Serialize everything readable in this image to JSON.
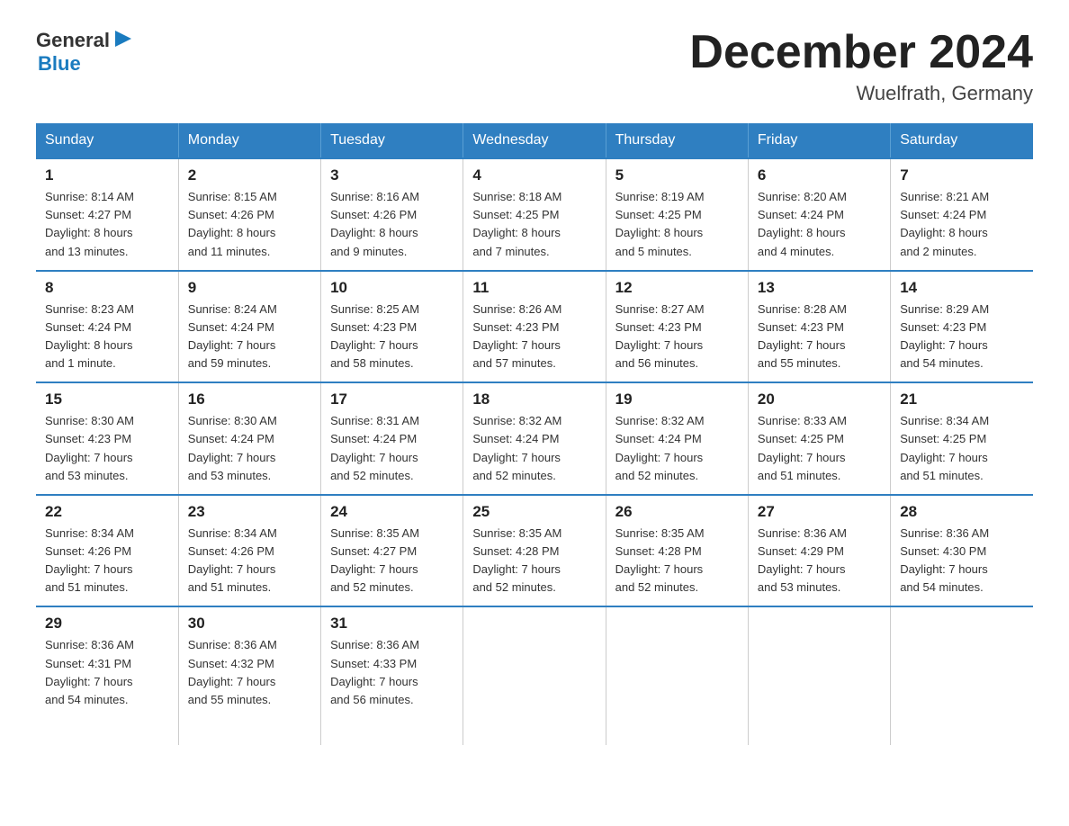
{
  "logo": {
    "text_general": "General",
    "text_blue": "Blue"
  },
  "header": {
    "month_year": "December 2024",
    "location": "Wuelfrath, Germany"
  },
  "days_of_week": [
    "Sunday",
    "Monday",
    "Tuesday",
    "Wednesday",
    "Thursday",
    "Friday",
    "Saturday"
  ],
  "weeks": [
    [
      {
        "day": "1",
        "info": "Sunrise: 8:14 AM\nSunset: 4:27 PM\nDaylight: 8 hours\nand 13 minutes."
      },
      {
        "day": "2",
        "info": "Sunrise: 8:15 AM\nSunset: 4:26 PM\nDaylight: 8 hours\nand 11 minutes."
      },
      {
        "day": "3",
        "info": "Sunrise: 8:16 AM\nSunset: 4:26 PM\nDaylight: 8 hours\nand 9 minutes."
      },
      {
        "day": "4",
        "info": "Sunrise: 8:18 AM\nSunset: 4:25 PM\nDaylight: 8 hours\nand 7 minutes."
      },
      {
        "day": "5",
        "info": "Sunrise: 8:19 AM\nSunset: 4:25 PM\nDaylight: 8 hours\nand 5 minutes."
      },
      {
        "day": "6",
        "info": "Sunrise: 8:20 AM\nSunset: 4:24 PM\nDaylight: 8 hours\nand 4 minutes."
      },
      {
        "day": "7",
        "info": "Sunrise: 8:21 AM\nSunset: 4:24 PM\nDaylight: 8 hours\nand 2 minutes."
      }
    ],
    [
      {
        "day": "8",
        "info": "Sunrise: 8:23 AM\nSunset: 4:24 PM\nDaylight: 8 hours\nand 1 minute."
      },
      {
        "day": "9",
        "info": "Sunrise: 8:24 AM\nSunset: 4:24 PM\nDaylight: 7 hours\nand 59 minutes."
      },
      {
        "day": "10",
        "info": "Sunrise: 8:25 AM\nSunset: 4:23 PM\nDaylight: 7 hours\nand 58 minutes."
      },
      {
        "day": "11",
        "info": "Sunrise: 8:26 AM\nSunset: 4:23 PM\nDaylight: 7 hours\nand 57 minutes."
      },
      {
        "day": "12",
        "info": "Sunrise: 8:27 AM\nSunset: 4:23 PM\nDaylight: 7 hours\nand 56 minutes."
      },
      {
        "day": "13",
        "info": "Sunrise: 8:28 AM\nSunset: 4:23 PM\nDaylight: 7 hours\nand 55 minutes."
      },
      {
        "day": "14",
        "info": "Sunrise: 8:29 AM\nSunset: 4:23 PM\nDaylight: 7 hours\nand 54 minutes."
      }
    ],
    [
      {
        "day": "15",
        "info": "Sunrise: 8:30 AM\nSunset: 4:23 PM\nDaylight: 7 hours\nand 53 minutes."
      },
      {
        "day": "16",
        "info": "Sunrise: 8:30 AM\nSunset: 4:24 PM\nDaylight: 7 hours\nand 53 minutes."
      },
      {
        "day": "17",
        "info": "Sunrise: 8:31 AM\nSunset: 4:24 PM\nDaylight: 7 hours\nand 52 minutes."
      },
      {
        "day": "18",
        "info": "Sunrise: 8:32 AM\nSunset: 4:24 PM\nDaylight: 7 hours\nand 52 minutes."
      },
      {
        "day": "19",
        "info": "Sunrise: 8:32 AM\nSunset: 4:24 PM\nDaylight: 7 hours\nand 52 minutes."
      },
      {
        "day": "20",
        "info": "Sunrise: 8:33 AM\nSunset: 4:25 PM\nDaylight: 7 hours\nand 51 minutes."
      },
      {
        "day": "21",
        "info": "Sunrise: 8:34 AM\nSunset: 4:25 PM\nDaylight: 7 hours\nand 51 minutes."
      }
    ],
    [
      {
        "day": "22",
        "info": "Sunrise: 8:34 AM\nSunset: 4:26 PM\nDaylight: 7 hours\nand 51 minutes."
      },
      {
        "day": "23",
        "info": "Sunrise: 8:34 AM\nSunset: 4:26 PM\nDaylight: 7 hours\nand 51 minutes."
      },
      {
        "day": "24",
        "info": "Sunrise: 8:35 AM\nSunset: 4:27 PM\nDaylight: 7 hours\nand 52 minutes."
      },
      {
        "day": "25",
        "info": "Sunrise: 8:35 AM\nSunset: 4:28 PM\nDaylight: 7 hours\nand 52 minutes."
      },
      {
        "day": "26",
        "info": "Sunrise: 8:35 AM\nSunset: 4:28 PM\nDaylight: 7 hours\nand 52 minutes."
      },
      {
        "day": "27",
        "info": "Sunrise: 8:36 AM\nSunset: 4:29 PM\nDaylight: 7 hours\nand 53 minutes."
      },
      {
        "day": "28",
        "info": "Sunrise: 8:36 AM\nSunset: 4:30 PM\nDaylight: 7 hours\nand 54 minutes."
      }
    ],
    [
      {
        "day": "29",
        "info": "Sunrise: 8:36 AM\nSunset: 4:31 PM\nDaylight: 7 hours\nand 54 minutes."
      },
      {
        "day": "30",
        "info": "Sunrise: 8:36 AM\nSunset: 4:32 PM\nDaylight: 7 hours\nand 55 minutes."
      },
      {
        "day": "31",
        "info": "Sunrise: 8:36 AM\nSunset: 4:33 PM\nDaylight: 7 hours\nand 56 minutes."
      },
      {
        "day": "",
        "info": ""
      },
      {
        "day": "",
        "info": ""
      },
      {
        "day": "",
        "info": ""
      },
      {
        "day": "",
        "info": ""
      }
    ]
  ]
}
